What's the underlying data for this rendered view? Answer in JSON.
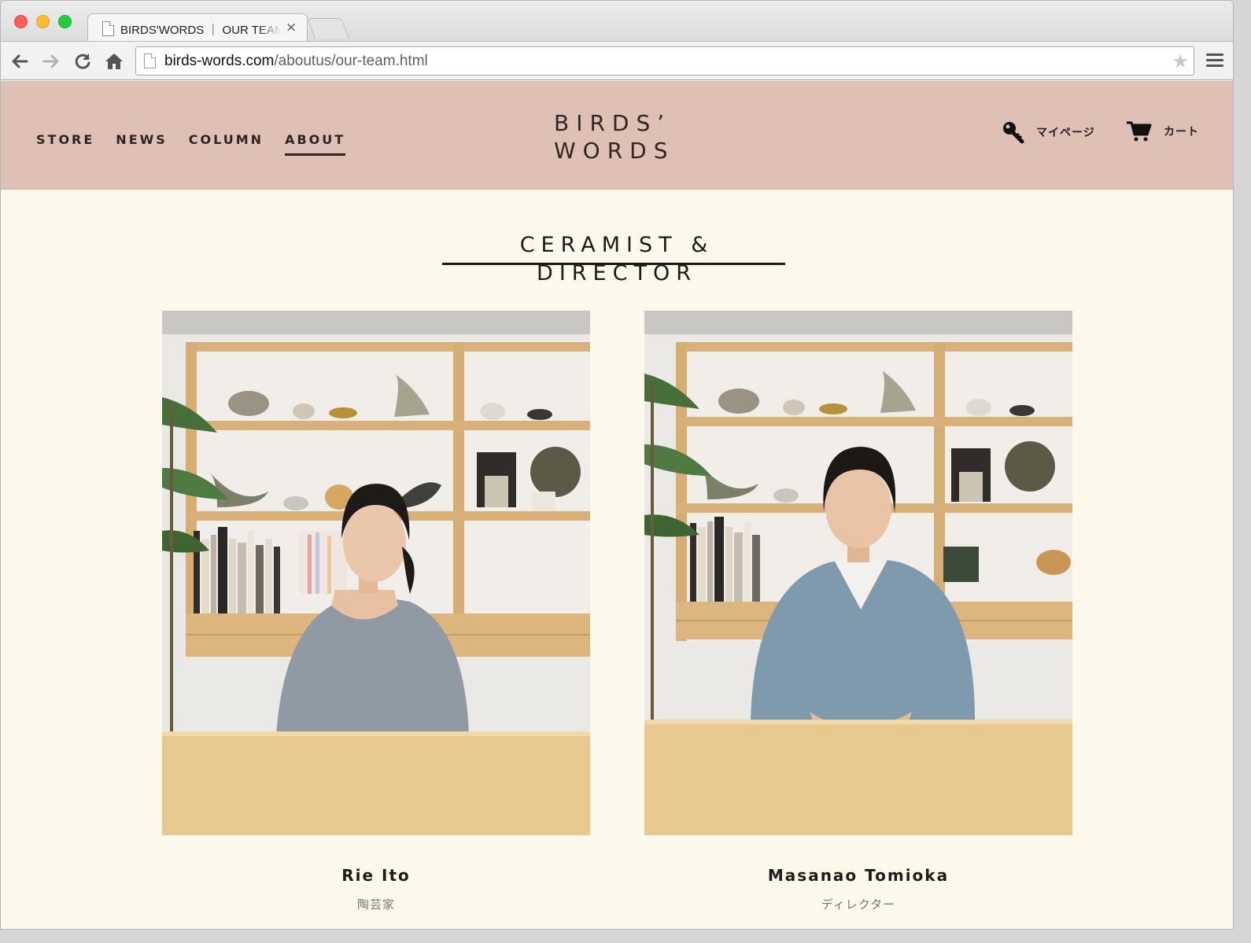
{
  "browser": {
    "tab_title": "BIRDS'WORDS ｜ OUR TEAM",
    "tab_close": "×",
    "url_host": "birds-words.com",
    "url_path": "/aboutus/our-team.html"
  },
  "header": {
    "nav": [
      {
        "label": "STORE"
      },
      {
        "label": "NEWS"
      },
      {
        "label": "COLUMN"
      },
      {
        "label": "ABOUT",
        "active": true
      }
    ],
    "logo_line1": "BIRDS’",
    "logo_line2": "WORDS",
    "mypage_label": "マイページ",
    "cart_label": "カート",
    "background": "#dec0b5"
  },
  "main": {
    "section_title": "CERAMIST & DIRECTOR",
    "members": [
      {
        "name": "Rie Ito",
        "role": "陶芸家"
      },
      {
        "name": "Masanao Tomioka",
        "role": "ディレクター"
      }
    ],
    "background": "#fdf8ec"
  },
  "icons": {
    "back": "arrow-left-icon",
    "forward": "arrow-right-icon",
    "reload": "reload-icon",
    "home": "home-icon",
    "bookmark": "star-icon",
    "menu": "hamburger-icon",
    "mypage": "key-icon",
    "cart": "cart-icon"
  }
}
